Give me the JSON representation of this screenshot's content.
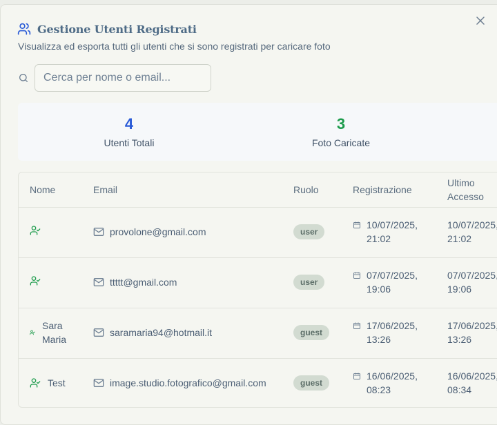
{
  "dialog": {
    "title": "Gestione Utenti Registrati",
    "subtitle": "Visualizza ed esporta tutti gli utenti che si sono registrati per caricare foto",
    "close_label": "×",
    "icons": {
      "title": "users-icon",
      "close": "close-icon",
      "search": "search-icon"
    }
  },
  "search": {
    "placeholder": "Cerca per nome o email...",
    "value": ""
  },
  "stats": {
    "total_users": {
      "value": "4",
      "label": "Utenti Totali",
      "color": "#2a5bd7"
    },
    "uploaded_photos": {
      "value": "3",
      "label": "Foto Caricate",
      "color": "#1c9b4b"
    }
  },
  "table": {
    "headers": {
      "name": "Nome",
      "email": "Email",
      "role": "Ruolo",
      "registration_line1": "Registrazione",
      "last_access_line1": "Ultimo",
      "last_access_line2": "Accesso"
    },
    "rows": [
      {
        "name_line1": "",
        "name_line2": "",
        "email": "provolone@gmail.com",
        "role": "user",
        "reg_date": "10/07/2025,",
        "reg_time": "21:02",
        "acc_date": "10/07/2025,",
        "acc_time": "21:02"
      },
      {
        "name_line1": "",
        "name_line2": "",
        "email": "ttttt@gmail.com",
        "role": "user",
        "reg_date": "07/07/2025,",
        "reg_time": "19:06",
        "acc_date": "07/07/2025,",
        "acc_time": "19:06"
      },
      {
        "name_line1": "Sara",
        "name_line2": "Maria",
        "email": "saramaria94@hotmail.it",
        "role": "guest",
        "reg_date": "17/06/2025,",
        "reg_time": "13:26",
        "acc_date": "17/06/2025,",
        "acc_time": "13:26"
      },
      {
        "name_line1": "Test",
        "name_line2": "",
        "email": "image.studio.fotografico@gmail.com",
        "role": "guest",
        "reg_date": "16/06/2025,",
        "reg_time": "08:23",
        "acc_date": "16/06/2025,",
        "acc_time": "08:34"
      }
    ],
    "icons": {
      "user": "user-check-icon",
      "email": "mail-icon",
      "date": "calendar-icon"
    }
  },
  "colors": {
    "accent_blue": "#2a5bd7",
    "accent_green": "#1c9b4b",
    "badge_bg": "#d2dbd1"
  }
}
